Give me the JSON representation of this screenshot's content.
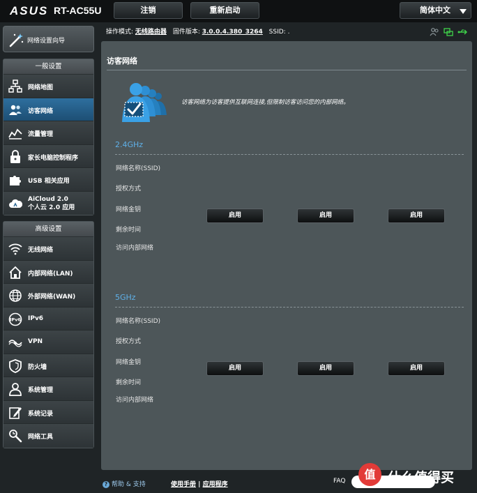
{
  "header": {
    "brand": "ASUS",
    "model": "RT-AC55U",
    "logout_label": "注销",
    "reboot_label": "重新启动",
    "language": "简体中文"
  },
  "status": {
    "mode_label": "操作模式:",
    "mode_value": "无线路由器",
    "firmware_label": "固件版本:",
    "firmware_value": "3.0.0.4.380_3264",
    "ssid_label": "SSID:",
    "ssid_value": "."
  },
  "sidebar": {
    "wizard_label": "网络设置向导",
    "general": {
      "title": "一般设置",
      "items": [
        {
          "label": "网络地图",
          "icon": "network-map-icon"
        },
        {
          "label": "访客网络",
          "icon": "guest-network-icon"
        },
        {
          "label": "流量管理",
          "icon": "traffic-icon"
        },
        {
          "label": "家长电脑控制程序",
          "icon": "parental-lock-icon"
        },
        {
          "label": "USB 相关应用",
          "icon": "usb-puzzle-icon"
        },
        {
          "label": "AiCloud 2.0",
          "label2": "个人云 2.0 应用",
          "icon": "aicloud-icon"
        }
      ]
    },
    "advanced": {
      "title": "高级设置",
      "items": [
        {
          "label": "无线网络",
          "icon": "wireless-icon"
        },
        {
          "label": "内部网络(LAN)",
          "icon": "home-lan-icon"
        },
        {
          "label": "外部网络(WAN)",
          "icon": "globe-wan-icon"
        },
        {
          "label": "IPv6",
          "icon": "ipv6-icon"
        },
        {
          "label": "VPN",
          "icon": "vpn-icon"
        },
        {
          "label": "防火墙",
          "icon": "shield-firewall-icon"
        },
        {
          "label": "系统管理",
          "icon": "admin-user-icon"
        },
        {
          "label": "系统记录",
          "icon": "log-icon"
        },
        {
          "label": "网络工具",
          "icon": "network-tools-icon"
        }
      ]
    }
  },
  "main": {
    "title": "访客网络",
    "description": "访客网络为访客提供互联网连接,但限制访客访问您的内部网络。",
    "bands": [
      {
        "name": "2.4GHz",
        "rows": [
          "网络名称(SSID)",
          "授权方式",
          "网络金钥",
          "剩余时间",
          "访问内部网络"
        ],
        "buttons": [
          "启用",
          "启用",
          "启用"
        ]
      },
      {
        "name": "5GHz",
        "rows": [
          "网络名称(SSID)",
          "授权方式",
          "网络金钥",
          "剩余时间",
          "访问内部网络"
        ],
        "buttons": [
          "启用",
          "启用",
          "启用"
        ]
      }
    ]
  },
  "footer": {
    "help_label": "帮助 & 支持",
    "manual_label": "使用手册",
    "separator": "|",
    "app_label": "应用程序",
    "faq_label": "FAQ"
  },
  "watermark": {
    "text": "什么值得买",
    "badge": "值"
  },
  "colors": {
    "accent": "#5fb0e8",
    "active_item": "#2a6793",
    "panel": "#4d5659"
  }
}
